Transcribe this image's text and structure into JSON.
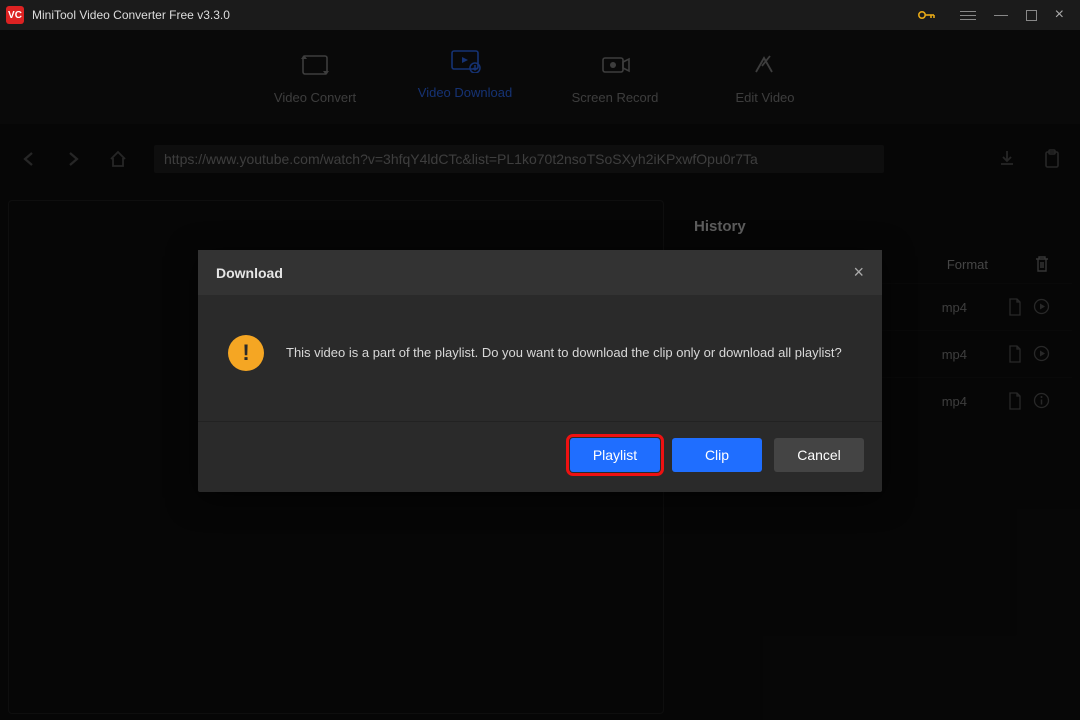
{
  "titlebar": {
    "title": "MiniTool Video Converter Free v3.3.0"
  },
  "nav": {
    "tabs": [
      {
        "label": "Video Convert"
      },
      {
        "label": "Video Download"
      },
      {
        "label": "Screen Record"
      },
      {
        "label": "Edit Video"
      }
    ],
    "active_index": 1
  },
  "toolbar": {
    "url": "https://www.youtube.com/watch?v=3hfqY4ldCTc&list=PL1ko70t2nsoTSoSXyh2iKPxwfOpu0r7Ta"
  },
  "history": {
    "heading": "History",
    "format_header": "Format",
    "items": [
      {
        "format": "mp4"
      },
      {
        "format": "mp4"
      },
      {
        "format": "mp4"
      }
    ]
  },
  "modal": {
    "title": "Download",
    "message": "This video is a part of the playlist. Do you want to download the clip only or download all playlist?",
    "playlist_label": "Playlist",
    "clip_label": "Clip",
    "cancel_label": "Cancel"
  }
}
